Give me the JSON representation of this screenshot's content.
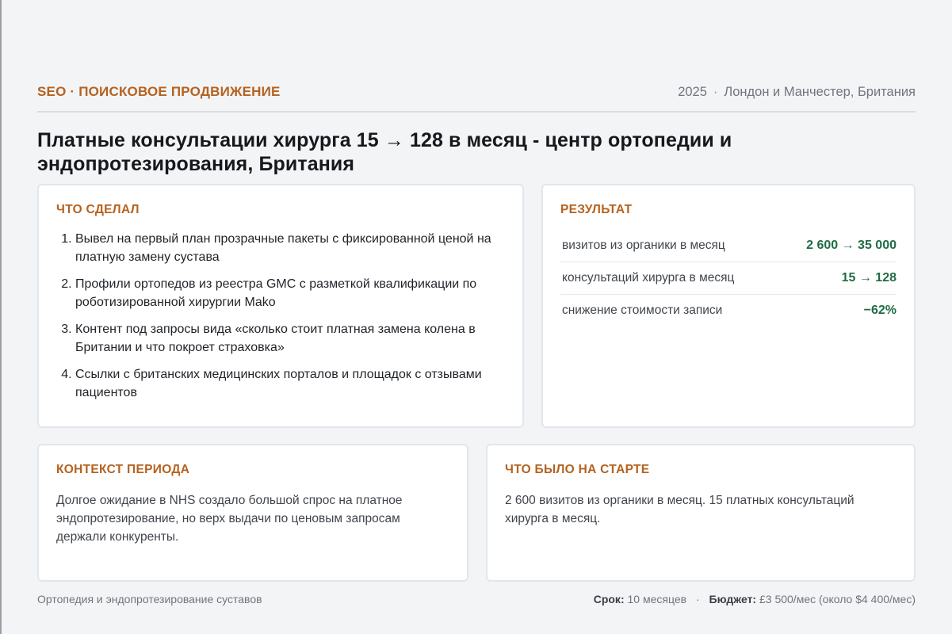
{
  "header": {
    "category": "SEO · ПОИСКОВОЕ ПРОДВИЖЕНИЕ",
    "year": "2025",
    "separator": "·",
    "location": "Лондон и Манчестер, Британия"
  },
  "title": "Платные консультации хирурга 15 → 128 в месяц - центр ортопедии и эндопротезирования, Британия",
  "what_done": {
    "heading": "ЧТО СДЕЛАЛ",
    "items": [
      "Вывел на первый план прозрачные пакеты с фиксированной ценой на платную замену сустава",
      "Профили ортопедов из реестра GMC с разметкой квалификации по роботизированной хирургии Mako",
      "Контент под запросы вида «сколько стоит платная замена колена в Британии и что покроет страховка»",
      "Ссылки с британских медицинских порталов и площадок с отзывами пациентов"
    ]
  },
  "results": {
    "heading": "РЕЗУЛЬТАТ",
    "rows": [
      {
        "label": "визитов из органики в месяц",
        "value": "2 600 → 35 000"
      },
      {
        "label": "консультаций хирурга в месяц",
        "value": "15 → 128"
      },
      {
        "label": "снижение стоимости записи",
        "value": "−62%"
      }
    ],
    "accent_color": "#226b45"
  },
  "context": {
    "heading": "КОНТЕКСТ ПЕРИОДА",
    "text": "Долгое ожидание в NHS создало большой спрос на платное эндопротезирование, но верх выдачи по ценовым запросам держали конкуренты."
  },
  "start": {
    "heading": "ЧТО БЫЛО НА СТАРТЕ",
    "text": "2 600 визитов из органики в месяц. 15 платных консультаций хирурга в месяц."
  },
  "footer": {
    "niche": "Ортопедия и эндопротезирование суставов",
    "term_label": "Срок:",
    "term_value": "10 месяцев",
    "separator": "·",
    "budget_label": "Бюджет:",
    "budget_value": "£3 500/мес (около $4 400/мес)"
  },
  "colors": {
    "accent": "#b5621f",
    "positive": "#226b45",
    "background": "#f3f4f6"
  }
}
